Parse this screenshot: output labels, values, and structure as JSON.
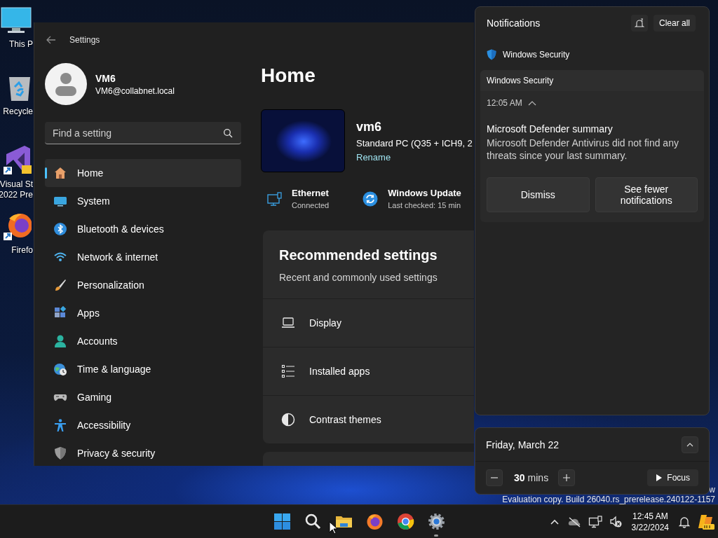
{
  "desktop": {
    "icons": [
      {
        "kind": "computer",
        "lines": [
          "This P"
        ]
      },
      {
        "kind": "recycle-bin",
        "lines": [
          "Recycle"
        ]
      },
      {
        "kind": "visual-studio",
        "lines": [
          "Visual St",
          "2022 Pre"
        ]
      },
      {
        "kind": "firefox",
        "lines": [
          "Firefo"
        ]
      }
    ],
    "watermark": [
      "w",
      "Evaluation copy. Build 26040.rs_prerelease.240122-1157"
    ]
  },
  "settings": {
    "title": "Settings",
    "user": {
      "name": "VM6",
      "email": "VM6@collabnet.local"
    },
    "search": {
      "placeholder": "Find a setting"
    },
    "nav": [
      {
        "kind": "home",
        "label": "Home",
        "selected": true
      },
      {
        "kind": "system",
        "label": "System",
        "selected": false
      },
      {
        "kind": "bluetooth",
        "label": "Bluetooth & devices",
        "selected": false
      },
      {
        "kind": "network",
        "label": "Network & internet",
        "selected": false
      },
      {
        "kind": "personalization",
        "label": "Personalization",
        "selected": false
      },
      {
        "kind": "apps",
        "label": "Apps",
        "selected": false
      },
      {
        "kind": "accounts",
        "label": "Accounts",
        "selected": false
      },
      {
        "kind": "time",
        "label": "Time & language",
        "selected": false
      },
      {
        "kind": "gaming",
        "label": "Gaming",
        "selected": false
      },
      {
        "kind": "accessibility",
        "label": "Accessibility",
        "selected": false
      },
      {
        "kind": "privacy",
        "label": "Privacy & security",
        "selected": false
      }
    ],
    "page_title": "Home",
    "device": {
      "name": "vm6",
      "model": "Standard PC (Q35 + ICH9, 2",
      "rename": "Rename"
    },
    "status": [
      {
        "kind": "ethernet",
        "title": "Ethernet",
        "subtitle": "Connected"
      },
      {
        "kind": "update",
        "title": "Windows Update",
        "subtitle": "Last checked: 15 min"
      }
    ],
    "recommended": {
      "title": "Recommended settings",
      "subtitle": "Recent and commonly used settings",
      "items": [
        {
          "kind": "display",
          "label": "Display"
        },
        {
          "kind": "installed-apps",
          "label": "Installed apps"
        },
        {
          "kind": "contrast",
          "label": "Contrast themes"
        }
      ]
    }
  },
  "notifications": {
    "title": "Notifications",
    "clear_all": "Clear all",
    "groups": [
      {
        "app": "Windows Security",
        "items": [
          {
            "header": "Windows Security",
            "time": "12:05 AM",
            "title": "Microsoft Defender summary",
            "body": "Microsoft Defender Antivirus did not find any threats since your last summary.",
            "actions": [
              "Dismiss",
              "See fewer notifications"
            ]
          }
        ]
      }
    ]
  },
  "focus": {
    "date": "Friday, March 22",
    "minutes": "30",
    "unit": "mins",
    "button": "Focus"
  },
  "taskbar": {
    "apps": [
      {
        "kind": "start",
        "running": false
      },
      {
        "kind": "search",
        "running": false
      },
      {
        "kind": "explorer",
        "running": false
      },
      {
        "kind": "firefox",
        "running": false
      },
      {
        "kind": "chrome",
        "running": false
      },
      {
        "kind": "settings",
        "running": true
      }
    ],
    "tray": [
      {
        "kind": "chevron"
      },
      {
        "kind": "cloud-off"
      },
      {
        "kind": "network"
      },
      {
        "kind": "muted"
      }
    ],
    "time": "12:45 AM",
    "date": "3/22/2024"
  }
}
